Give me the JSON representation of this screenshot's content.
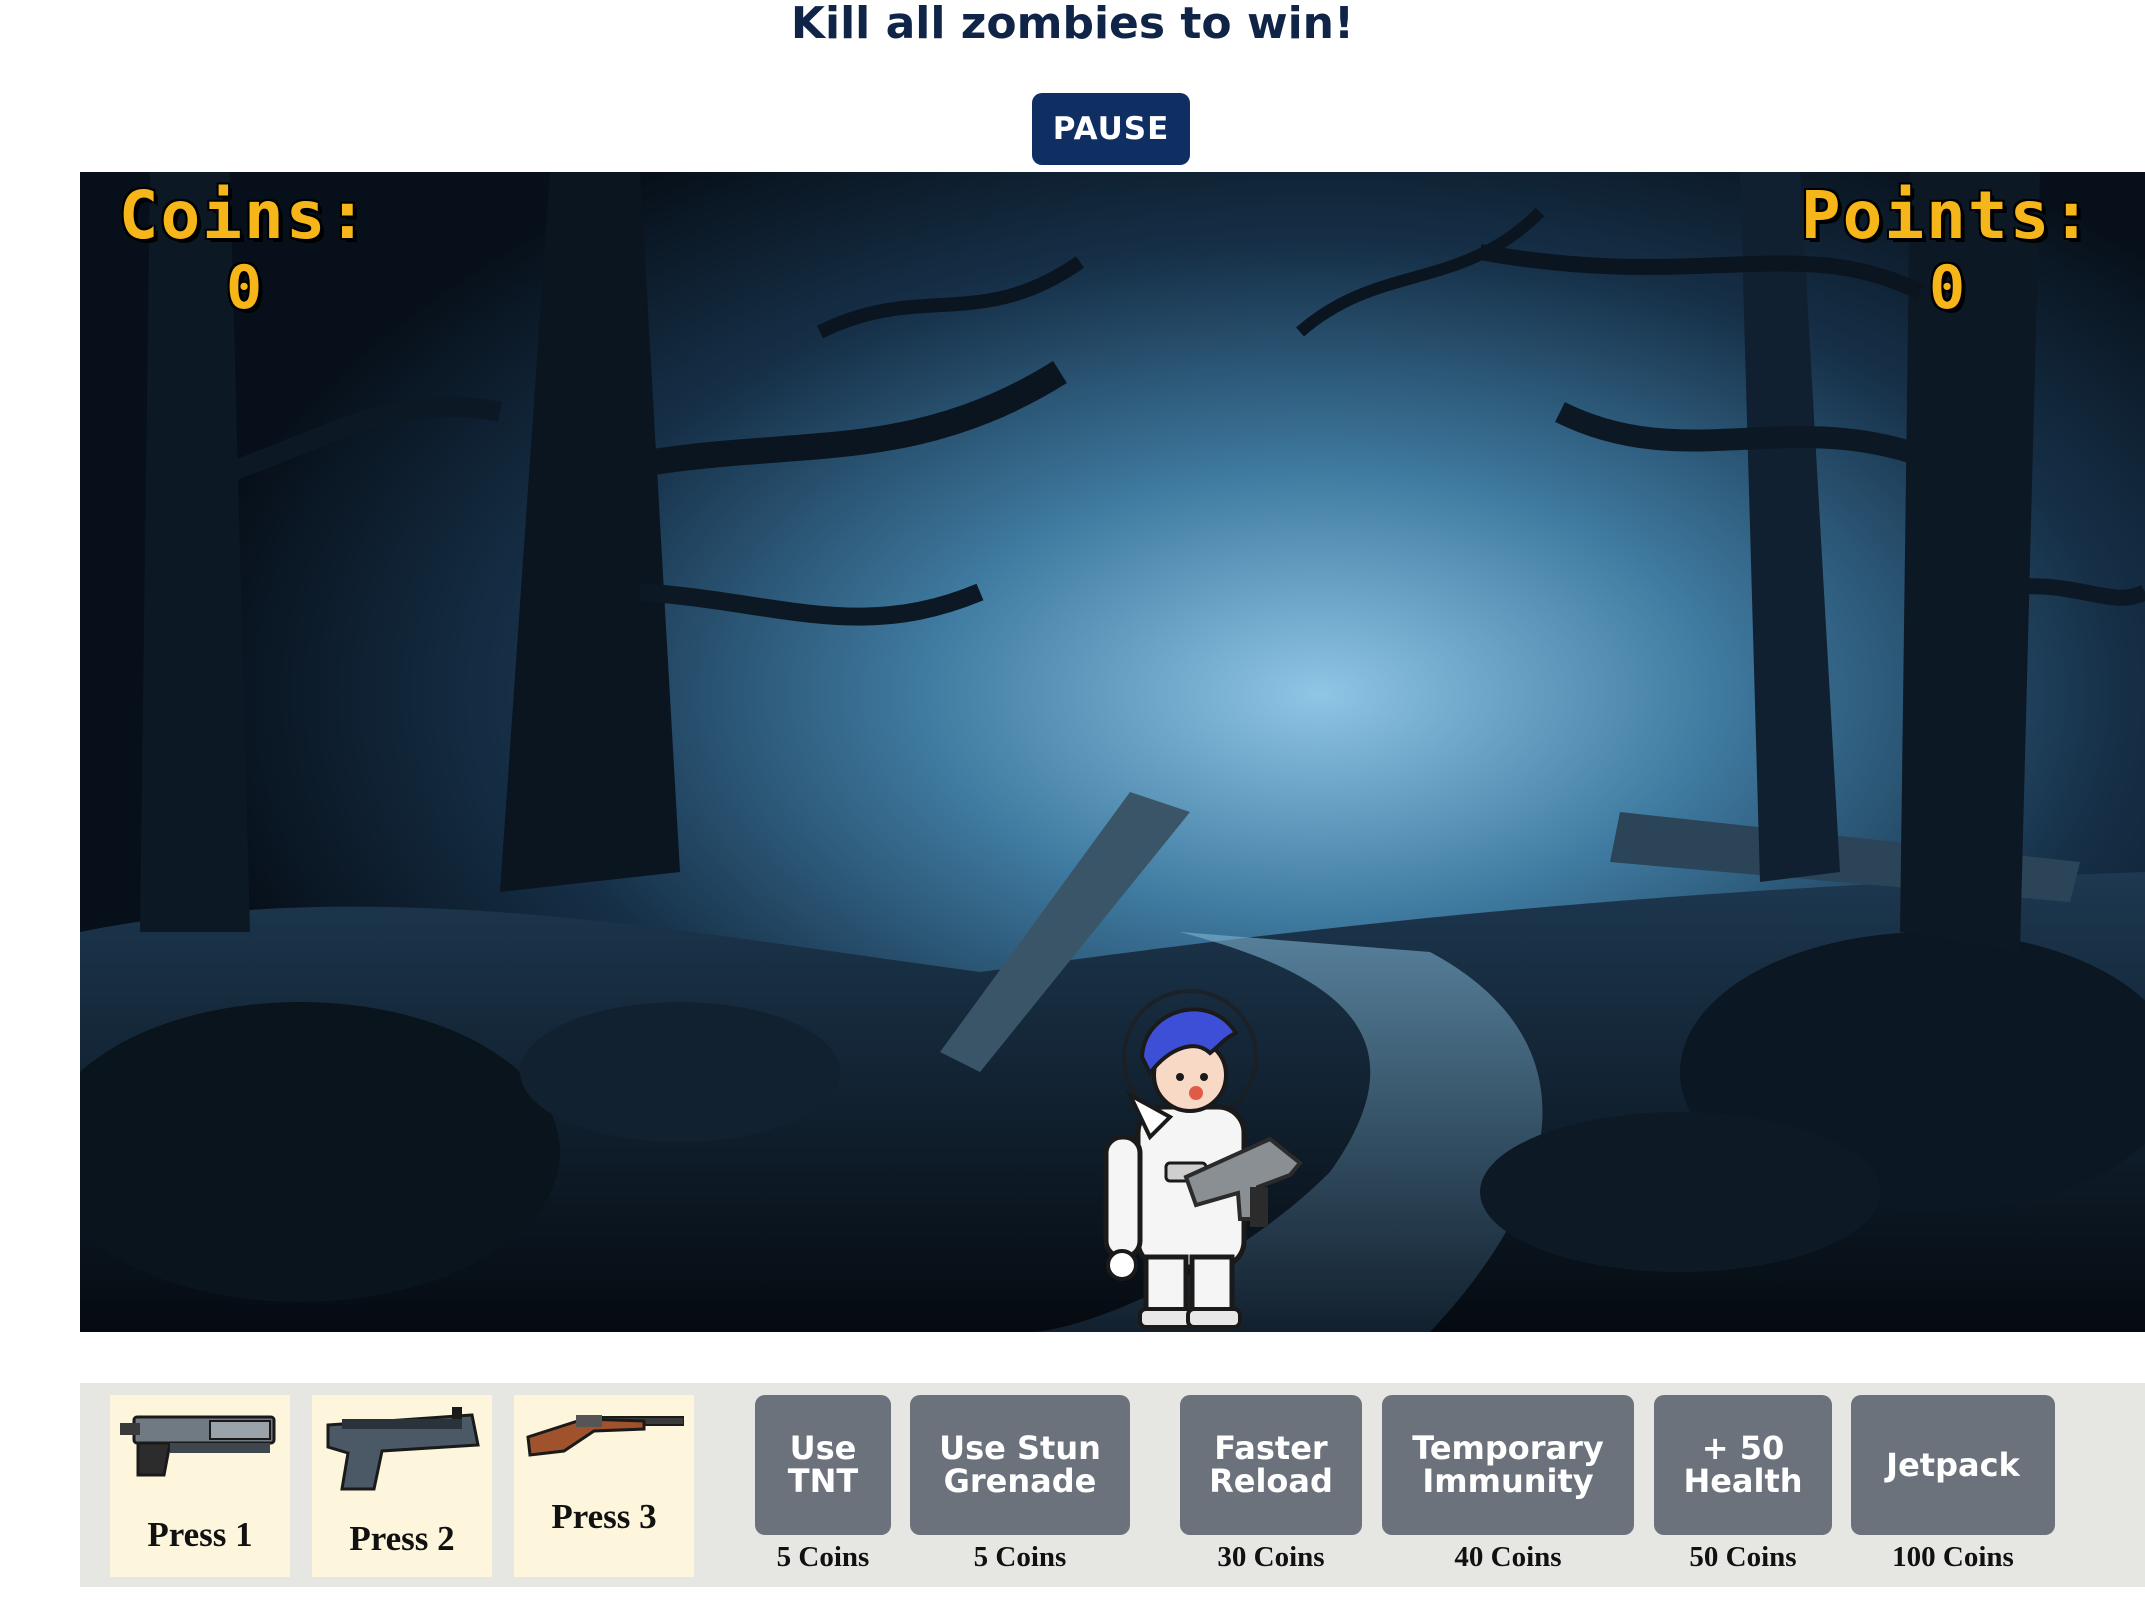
{
  "title": "Kill all zombies to win!",
  "pause_label": "PAUSE",
  "hud": {
    "coins_label": "Coins:",
    "coins_value": "0",
    "points_label": "Points:",
    "points_value": "0",
    "color": "#f6b61a"
  },
  "weapons": [
    {
      "label": "Press 1",
      "icon": "laser-pistol-icon"
    },
    {
      "label": "Press 2",
      "icon": "pistol-icon"
    },
    {
      "label": "Press 3",
      "icon": "rifle-icon"
    }
  ],
  "shop": [
    {
      "label": "Use TNT",
      "cost": "5 Coins"
    },
    {
      "label": "Use Stun Grenade",
      "cost": "5 Coins"
    },
    {
      "label": "Faster Reload",
      "cost": "30 Coins"
    },
    {
      "label": "Temporary Immunity",
      "cost": "40 Coins"
    },
    {
      "label": "+ 50 Health",
      "cost": "50 Coins"
    },
    {
      "label": "Jetpack",
      "cost": "100 Coins"
    }
  ],
  "colors": {
    "title": "#0f2446",
    "pause_bg": "#0f2f63",
    "shop_button": "#6c727b",
    "weapon_slot": "#fdf6dc",
    "tray": "#e6e6e3"
  }
}
